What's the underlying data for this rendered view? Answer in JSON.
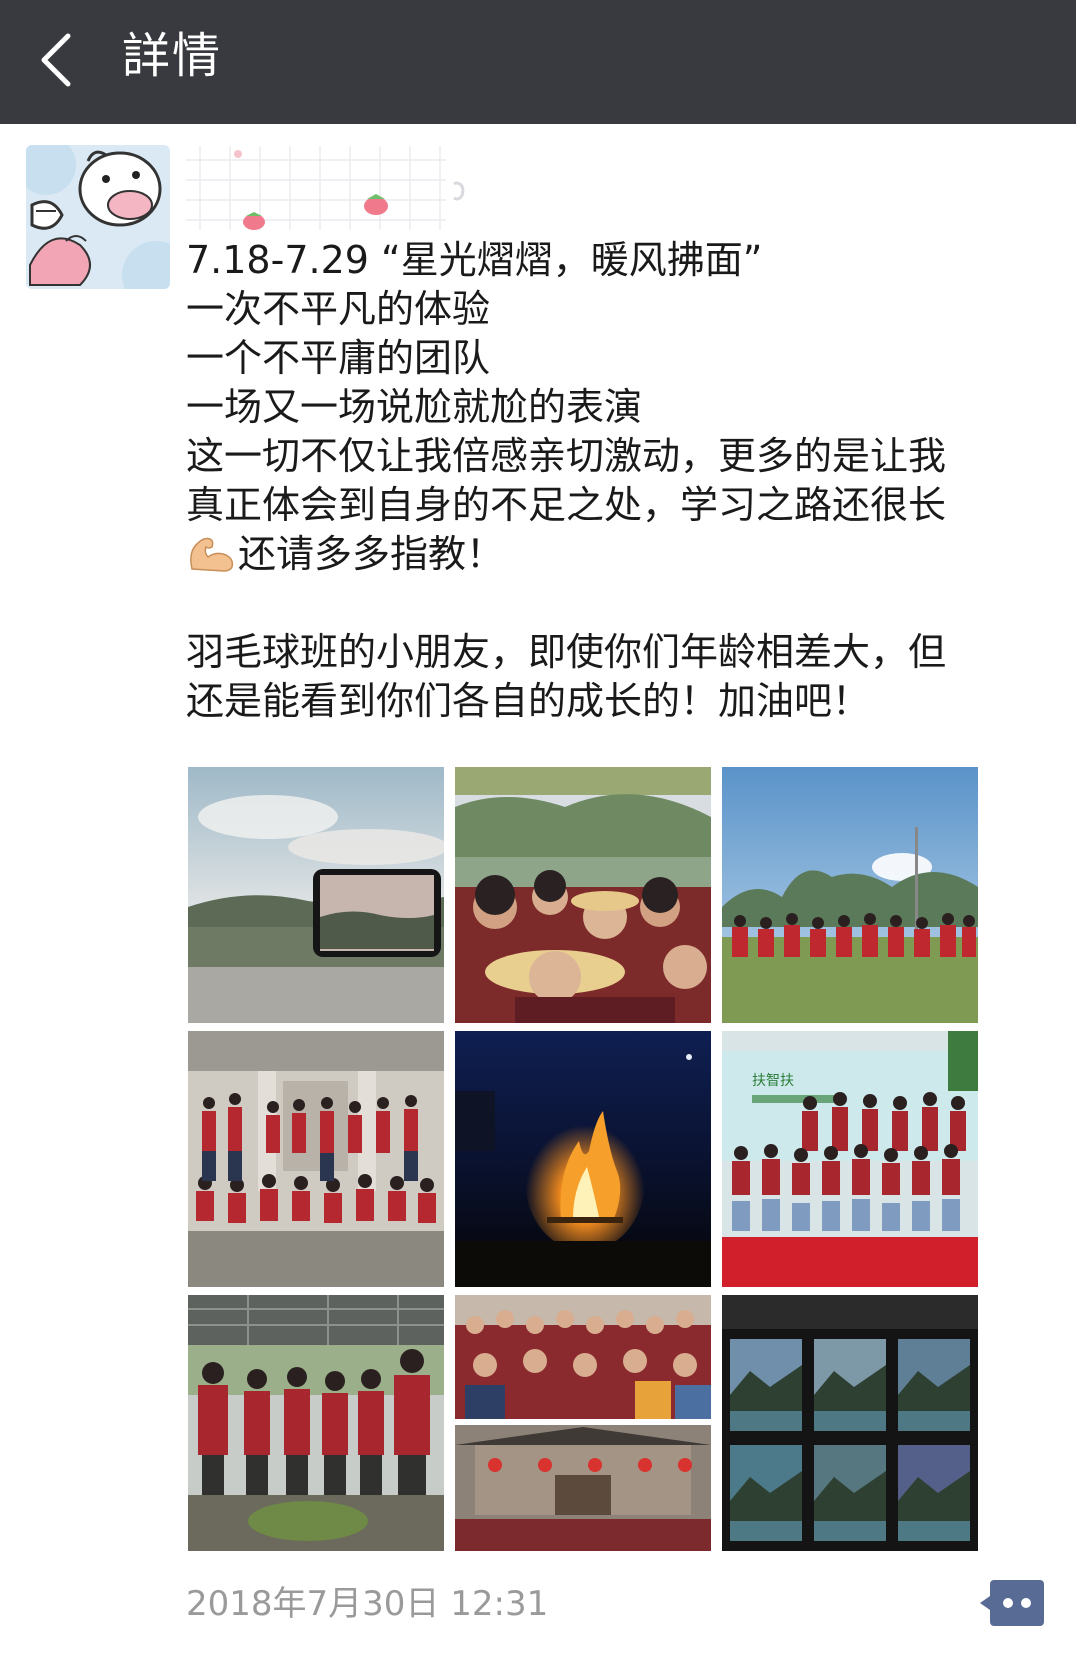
{
  "header": {
    "title": "詳情",
    "back_icon": "chevron-left-icon"
  },
  "post": {
    "lines": [
      "7.18-7.29 “星光熠熠，暖风拂面”",
      "一次不平凡的体验",
      "一个不平庸的团队",
      "一场又一场说尬就尬的表演",
      "这一切不仅让我倍感亲切激动，更多的是让我",
      "真正体会到自身的不足之处，学习之路还很长"
    ],
    "emoji": "muscle-emoji-icon",
    "line_after_emoji": "还请多多指教！",
    "lines_2": [
      "羽毛球班的小朋友，即使你们年龄相差大，但",
      "还是能看到你们各自的成长的！加油吧！"
    ],
    "timestamp": "2018年7月30日 12:31"
  },
  "photos": [
    {
      "name": "photo-landscape-phone",
      "desc_icon": "image-icon"
    },
    {
      "name": "photo-group-selfie",
      "desc_icon": "image-icon"
    },
    {
      "name": "photo-field-group",
      "desc_icon": "image-icon"
    },
    {
      "name": "photo-building-group",
      "desc_icon": "image-icon"
    },
    {
      "name": "photo-bonfire",
      "desc_icon": "image-icon"
    },
    {
      "name": "photo-stage-group",
      "desc_icon": "image-icon"
    },
    {
      "name": "photo-shelter-group",
      "desc_icon": "image-icon"
    },
    {
      "name": "photo-collage-temple",
      "desc_icon": "image-icon"
    },
    {
      "name": "photo-mountain-grid",
      "desc_icon": "image-icon"
    }
  ],
  "colors": {
    "topbar": "#393a3f",
    "text": "#1a1a1a",
    "timestamp": "#9a9a9a",
    "accent": "#576b95",
    "shirt_red": "#a8262e"
  }
}
